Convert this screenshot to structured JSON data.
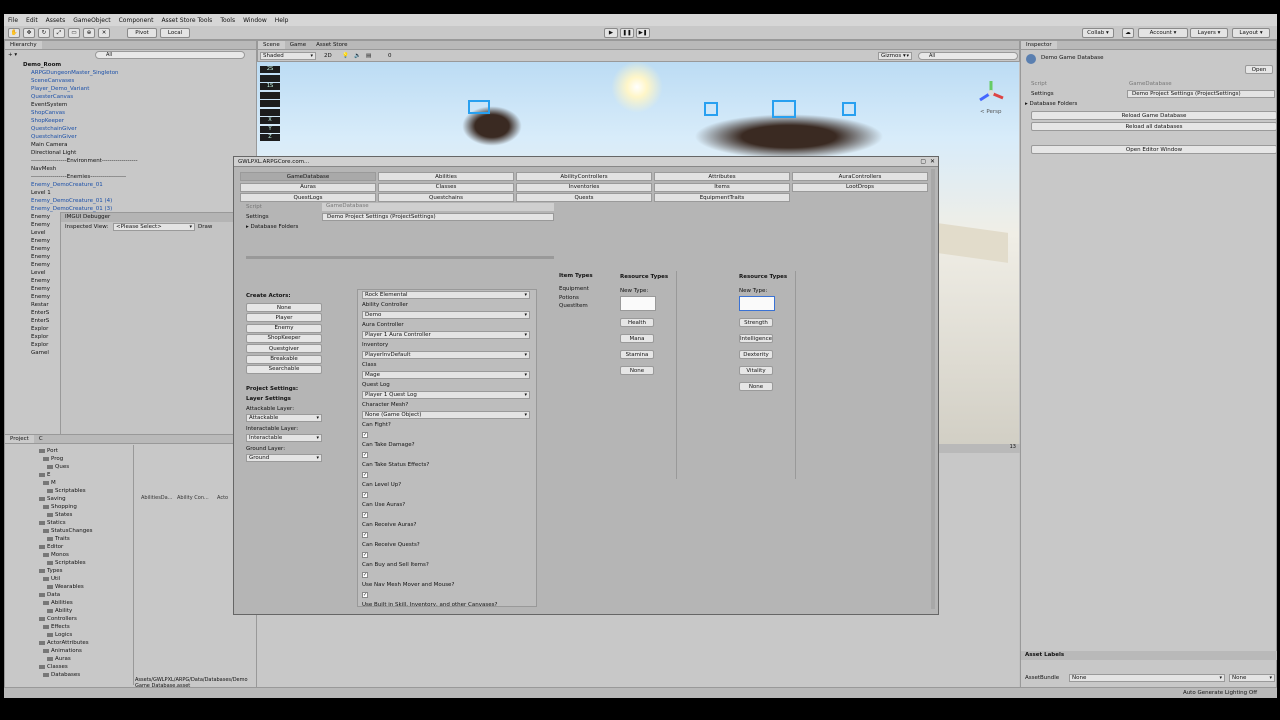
{
  "menu": [
    "File",
    "Edit",
    "Assets",
    "GameObject",
    "Component",
    "Asset Store Tools",
    "Tools",
    "Window",
    "Help"
  ],
  "toolbar": {
    "pivot": "Pivot",
    "local": "Local",
    "collab": "Collab ▾",
    "account": "Account ▾",
    "layers": "Layers ▾",
    "layout": "Layout ▾"
  },
  "hierarchy": {
    "tab": "Hierarchy",
    "create": "+ ▾",
    "search_placeholder": "All",
    "scene": "Demo_Room",
    "items": [
      "ARPGDungeonMaster_Singleton",
      "SceneCanvases",
      "Player_Demo_Variant",
      "QuesterCanvas",
      "EventSystem",
      "ShopCanvas",
      "ShopKeeper",
      "QuestchainGiver",
      "QuestchainGiver",
      "Main Camera",
      "Directional Light",
      "------------------Environment------------------",
      "NavMesh",
      "------------------Enemies------------------",
      "Enemy_DemoCreature_01",
      "Level 1",
      "Enemy_DemoCreature_01 (4)",
      "Enemy_DemoCreature_01 (3)",
      "Enemy",
      "Enemy",
      "Level",
      "Enemy",
      "Enemy",
      "Enemy",
      "Enemy",
      "Level",
      "Enemy",
      "Enemy",
      "Enemy",
      "Restar",
      "EnterS",
      "EnterS",
      "Explor",
      "Explor",
      "Explor",
      "Gamel"
    ]
  },
  "imgui": {
    "title": "IMGUI Debugger",
    "inspected_label": "Inspected View:",
    "inspected_value": "<Please Select>",
    "draw": "Draw"
  },
  "scene_tabs": [
    "Scene",
    "Game",
    "Asset Store"
  ],
  "scene_toolbar": {
    "shading": "Shaded",
    "mode": "2D",
    "gizmos": "Gizmos ▾",
    "search": "All",
    "counter": "0"
  },
  "scene_overlay": [
    "2S",
    "",
    "1S",
    "",
    "",
    "",
    "X",
    "Y",
    "Z"
  ],
  "persp": "< Persp",
  "project": {
    "tabs": [
      "Project",
      "C"
    ],
    "folders": [
      "Port",
      "Prog",
      "Ques",
      "E",
      "M",
      "Scriptables",
      "Saving",
      "Shopping",
      "States",
      "Statics",
      "StatusChanges",
      "Traits",
      "Editor",
      "Monos",
      "Scriptables",
      "Types",
      "Util",
      "Wearables",
      "Data",
      "Abilities",
      "Ability",
      "Controllers",
      "Effects",
      "Logics",
      "ActorAttributes",
      "Animations",
      "Auras",
      "Classes",
      "Databases"
    ],
    "assets": [
      "AbilitiesDa...",
      "Ability Con...",
      "Acto"
    ],
    "path": "Assets/GWLPXL/ARPG/Data/Databases/Demo Game Database.asset"
  },
  "dialog": {
    "title": "GWLPXL.ARPGCore.com...",
    "tabs_row1": [
      "GameDatabase",
      "Abilities",
      "AbilityControllers",
      "Attributes",
      "AuraControllers"
    ],
    "tabs_row2": [
      "Auras",
      "Classes",
      "Inventories",
      "Items",
      "LootDrops"
    ],
    "tabs_row3": [
      "QuestLogs",
      "Questchains",
      "Quests",
      "EquipmentTraits"
    ],
    "script_label": "Script",
    "script_value": "GameDatabase",
    "settings_label": "Settings",
    "settings_value": "Demo Project Settings (ProjectSettings)",
    "db_folders": "▸ Database Folders",
    "create_actors": "Create Actors:",
    "actor_buttons": [
      "None",
      "Player",
      "Enemy",
      "ShopKeeper",
      "Questgiver",
      "Breakable",
      "Searchable"
    ],
    "project_settings": "Project Settings:",
    "layer_settings": "Layer Settings",
    "attackable_label": "Attackable Layer:",
    "attackable_value": "Attackable",
    "interactable_label": "Interactable Layer:",
    "interactable_value": "Interactable",
    "ground_label": "Ground Layer:",
    "ground_value": "Ground",
    "fields": [
      {
        "label": "",
        "value": "Rock Elemental"
      },
      {
        "label": "Ability Controller",
        "value": "Demo"
      },
      {
        "label": "Aura Controller",
        "value": "Player 1 Aura Controller"
      },
      {
        "label": "Inventory",
        "value": "PlayerInvDefault"
      },
      {
        "label": "Class",
        "value": "Mage"
      },
      {
        "label": "Quest Log",
        "value": "Player 1 Quest Log"
      },
      {
        "label": "Character Mesh?",
        "value": "None (Game Object)"
      }
    ],
    "checks": [
      "Can Fight?",
      "Can Take Damage?",
      "Can Take Status Effects?",
      "Can Level Up?",
      "Can Use Auras?",
      "Can Receive Auras?",
      "Can Receive Quests?",
      "Can Buy and Sell Items?",
      "Use Nav Mesh Mover and Mouse?",
      "Use Built in Skill, Inventory, and other Canvases?"
    ],
    "item_types_title": "Item Types",
    "item_types": [
      "Equipment",
      "Potions",
      "QuestItem"
    ],
    "res1_title": "Resource Types",
    "res1_new": "New Type:",
    "res1_buttons": [
      "Health",
      "Mana",
      "Stamina",
      "None"
    ],
    "res2_title": "Resource Types",
    "res2_new": "New Type:",
    "res2_buttons": [
      "Strength",
      "Intelligence",
      "Dexterity",
      "Vitality",
      "None"
    ]
  },
  "inspector": {
    "tab": "Inspector",
    "title": "Demo Game Database",
    "open": "Open",
    "script_label": "Script",
    "script_value": "GameDatabase",
    "settings_label": "Settings",
    "settings_value": "Demo Project Settings (ProjectSettings)",
    "db_folders": "▸ Database Folders",
    "reload": "Reload Game Database",
    "reload_all": "Reload all databases",
    "open_editor": "Open Editor Window",
    "asset_labels": "Asset Labels",
    "asset_bundle": "AssetBundle",
    "bundle_value": "None",
    "bundle_value2": "None"
  },
  "status": {
    "right": "Auto Generate Lighting Off"
  },
  "console_count": "13"
}
